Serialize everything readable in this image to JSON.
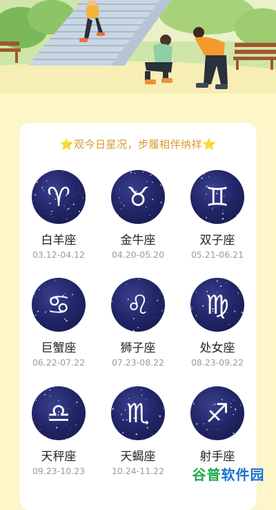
{
  "hero": {
    "image_alt": "people exercising on park stairs illustration"
  },
  "slogan": {
    "star_left": "⭐",
    "text": "观今日星况，步履相伴纳祥",
    "star_right": "⭐"
  },
  "signs": [
    {
      "name": "白羊座",
      "dates": "03.12-04.12",
      "symbol": "♈",
      "icon": "aries-icon"
    },
    {
      "name": "金牛座",
      "dates": "04.20-05.20",
      "symbol": "♉",
      "icon": "taurus-icon"
    },
    {
      "name": "双子座",
      "dates": "05.21-06.21",
      "symbol": "♊",
      "icon": "gemini-icon"
    },
    {
      "name": "巨蟹座",
      "dates": "06.22-07.22",
      "symbol": "♋",
      "icon": "cancer-icon"
    },
    {
      "name": "狮子座",
      "dates": "07.23-08.22",
      "symbol": "♌",
      "icon": "leo-icon"
    },
    {
      "name": "处女座",
      "dates": "08.23-09.22",
      "symbol": "♍",
      "icon": "virgo-icon"
    },
    {
      "name": "天秤座",
      "dates": "09.23-10.23",
      "symbol": "♎",
      "icon": "libra-icon"
    },
    {
      "name": "天蝎座",
      "dates": "10.24-11.22",
      "symbol": "♏",
      "icon": "scorpio-icon"
    },
    {
      "name": "射手座",
      "dates": "",
      "symbol": "♐",
      "icon": "sagittarius-icon"
    }
  ],
  "watermark": {
    "part1": "谷普",
    "part2": "软件园"
  },
  "colors": {
    "background": "#fdf6c8",
    "slogan": "#d49a2a",
    "circle": "#23276a"
  }
}
